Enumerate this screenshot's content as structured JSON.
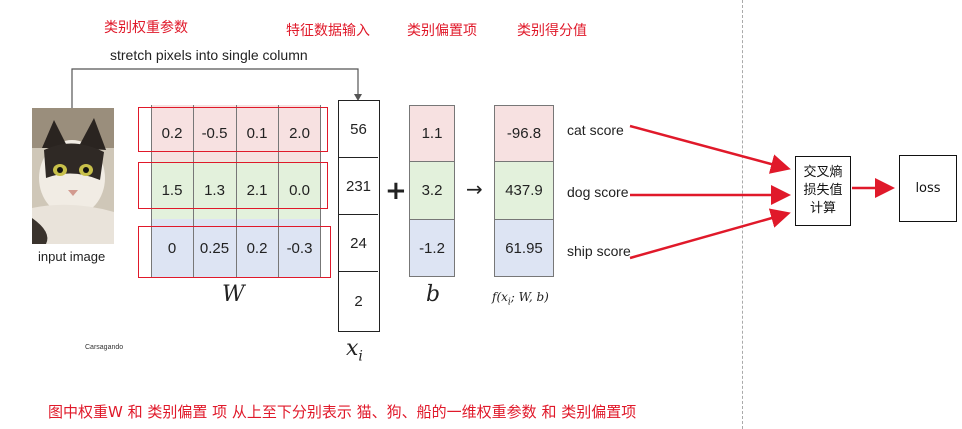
{
  "labels": {
    "weights": "类别权重参数",
    "input": "特征数据输入",
    "bias": "类别偏置项",
    "score": "类别得分值"
  },
  "slide": {
    "stretch_caption": "stretch pixels into single column",
    "input_image_label": "input image",
    "W_symbol": "W",
    "x_symbol": "x_i",
    "b_symbol": "b",
    "f_symbol": "f(x_i; W, b)",
    "plus": "+",
    "arrow": "→",
    "watermark": "Carsagando",
    "W_rows": [
      [
        "0.2",
        "-0.5",
        "0.1",
        "2.0"
      ],
      [
        "1.5",
        "1.3",
        "2.1",
        "0.0"
      ],
      [
        "0",
        "0.25",
        "0.2",
        "-0.3"
      ]
    ],
    "x_values": [
      "56",
      "231",
      "24",
      "2"
    ],
    "b_values": [
      "1.1",
      "3.2",
      "-1.2"
    ],
    "f_values": [
      "-96.8",
      "437.9",
      "61.95"
    ],
    "score_labels": [
      "cat score",
      "dog score",
      "ship score"
    ]
  },
  "flow": {
    "cross_entropy_box": "交叉熵\n损失值\n计算",
    "loss_box": "loss"
  },
  "bottom_note": "图中权重W 和 类别偏置 项 从上至下分别表示 猫、狗、船的一维权重参数 和 类别偏置项",
  "colors": {
    "annotation_red": "#e0192a",
    "row_red": "#f7e1e1",
    "row_green": "#e3f1dc",
    "row_blue": "#dde4f3"
  }
}
